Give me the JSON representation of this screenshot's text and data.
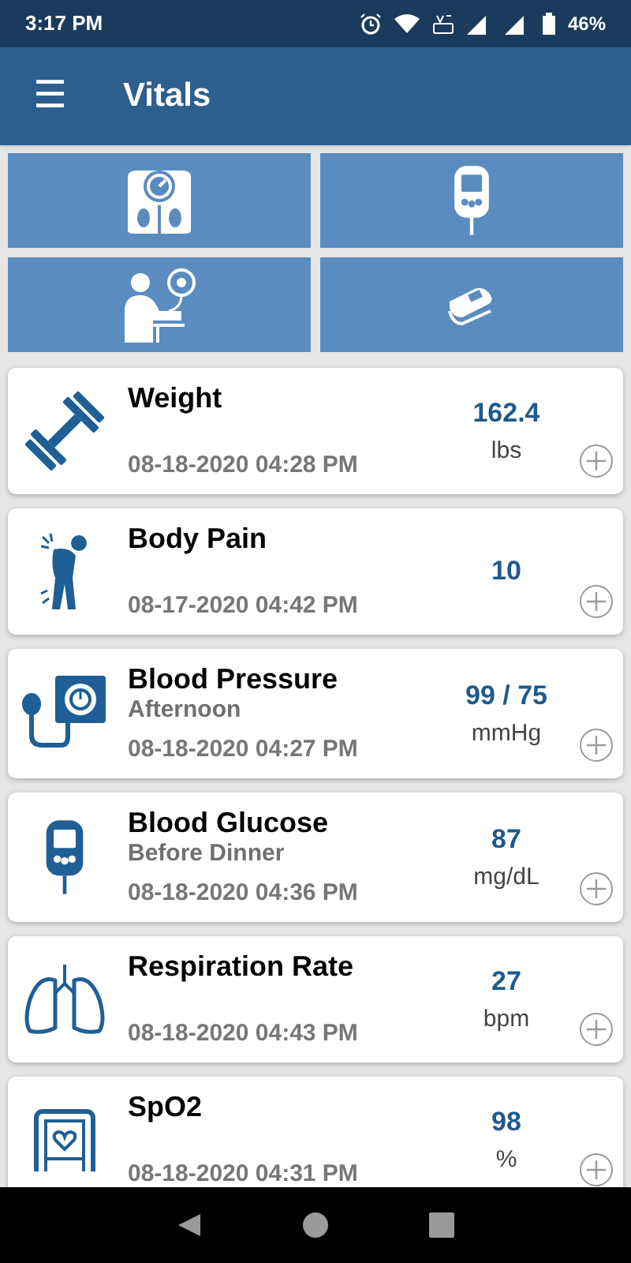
{
  "status_bar": {
    "time": "3:17 PM",
    "battery": "46%"
  },
  "app_bar": {
    "menu": "☰",
    "title": "Vitals"
  },
  "vitals": [
    {
      "title": "Weight",
      "date": "08-18-2020 04:28 PM",
      "value": "162.4",
      "unit": "lbs"
    },
    {
      "title": "Body Pain",
      "date": "08-17-2020 04:42 PM",
      "value": "10"
    },
    {
      "title": "Blood Pressure",
      "subtitle": "Afternoon",
      "date": "08-18-2020 04:27 PM",
      "value": "99 / 75",
      "unit": "mmHg"
    },
    {
      "title": "Blood Glucose",
      "subtitle": "Before Dinner",
      "date": "08-18-2020 04:36 PM",
      "value": "87",
      "unit": "mg/dL"
    },
    {
      "title": "Respiration Rate",
      "date": "08-18-2020 04:43 PM",
      "value": "27",
      "unit": "bpm"
    },
    {
      "title": "SpO2",
      "date": "08-18-2020 04:31 PM",
      "value": "98",
      "unit": "%"
    }
  ]
}
